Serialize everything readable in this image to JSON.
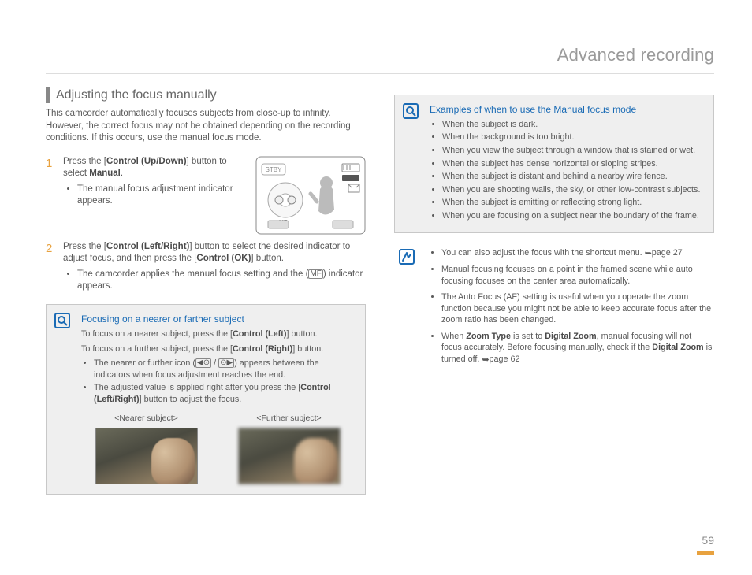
{
  "header": {
    "title": "Advanced recording"
  },
  "pageNumber": "59",
  "left": {
    "sectionTitle": "Adjusting the focus manually",
    "intro": "This camcorder automatically focuses subjects from close-up to infinity. However, the correct focus may not be obtained depending on the recording conditions. If this occurs, use the manual focus mode.",
    "steps": [
      {
        "num": "1",
        "lead_pre": "Press the [",
        "lead_bold": "Control (Up/Down)",
        "lead_mid": "] button to select ",
        "lead_bold2": "Manual",
        "lead_post": ".",
        "bullets": [
          "The manual focus adjustment indicator appears."
        ]
      },
      {
        "num": "2",
        "lead_pre": "Press the [",
        "lead_bold": "Control (Left/Right)",
        "lead_mid": "] button to select the desired indicator to adjust focus, and then press the [",
        "lead_bold2": "Control (OK)",
        "lead_post": "] button.",
        "bullets_rich": {
          "pre": "The camcorder applies the manual focus setting and the (",
          "icon": "MF",
          "post": ") indicator appears."
        }
      }
    ],
    "callout": {
      "title": "Focusing on a nearer or farther subject",
      "line1_pre": "To focus on a nearer subject, press the [",
      "line1_bold": "Control (Left)",
      "line1_post": "] button.",
      "line2_pre": "To focus on a further subject, press the [",
      "line2_bold": "Control (Right)",
      "line2_post": "] button.",
      "bullets": [
        {
          "pre": "The nearer or further icon (",
          "icon1": "◀⊙",
          "mid": " / ",
          "icon2": "⊙▶",
          "post": ") appears between the indicators when focus adjustment reaches the end."
        },
        {
          "pre": "The adjusted value is applied right after you press the [",
          "bold": "Control (Left/Right)",
          "post": "] button to adjust the focus."
        }
      ],
      "figs": [
        {
          "cap": "<Nearer subject>"
        },
        {
          "cap": "<Further subject>"
        }
      ]
    }
  },
  "right": {
    "callout": {
      "title": "Examples of when to use the Manual focus mode",
      "bullets": [
        "When the subject is dark.",
        "When the background is too bright.",
        "When you view the subject through a window that is stained or wet.",
        "When the subject has dense horizontal or sloping stripes.",
        "When the subject is distant and behind a nearby wire fence.",
        "When you are shooting walls, the sky, or other low-contrast subjects.",
        "When the subject is emitting or reflecting strong light.",
        "When you are focusing on a subject near the boundary of the frame."
      ]
    },
    "note": {
      "bullets": [
        {
          "text_pre": "You can also adjust the focus with the shortcut menu. ",
          "arrow": "➥",
          "text_post": "page 27"
        },
        {
          "text": "Manual focusing focuses on a point in the framed scene while auto focusing focuses on the center area automatically."
        },
        {
          "text": "The Auto Focus (AF) setting is useful when you operate the zoom function because you might not be able to keep accurate focus after the zoom ratio has been changed."
        },
        {
          "pre": "When ",
          "b1": "Zoom Type",
          "mid1": " is set to ",
          "b2": "Digital Zoom",
          "mid2": ", manual focusing will not focus accurately. Before focusing manually, check if the ",
          "b3": "Digital Zoom",
          "post": " is turned off. ",
          "arrow": "➥",
          "page": "page 62"
        }
      ]
    }
  }
}
